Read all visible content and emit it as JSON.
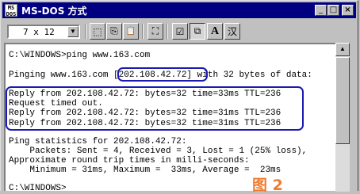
{
  "window": {
    "title": "MS-DOS 方式",
    "app_icon_text": "MS\nDOS",
    "minimize_glyph": "_",
    "maximize_glyph": "□",
    "close_glyph": "×"
  },
  "toolbar": {
    "font_size_value": "7 x 12",
    "dropdown_glyph": "▼",
    "tool_glyphs": {
      "mark": "⬚",
      "copy": "⎘",
      "paste": "📋",
      "fullscreen": "⛶",
      "properties": "☑",
      "background": "⧉",
      "font": "A",
      "ime": "汉"
    }
  },
  "console": {
    "lines": [
      "C:\\WINDOWS>ping www.163.com",
      "",
      "Pinging www.163.com [202.108.42.72] with 32 bytes of data:",
      "",
      "Reply from 202.108.42.72: bytes=32 time=33ms TTL=236",
      "Request timed out.",
      "Reply from 202.108.42.72: bytes=32 time=31ms TTL=236",
      "Reply from 202.108.42.72: bytes=32 time=31ms TTL=236",
      "",
      "Ping statistics for 202.108.42.72:",
      "    Packets: Sent = 4, Received = 3, Lost = 1 (25% loss),",
      "Approximate round trip times in milli-seconds:",
      "    Minimum = 31ms, Maximum =  33ms, Average =  23ms",
      "",
      "C:\\WINDOWS>"
    ]
  },
  "scrollbar": {
    "up_glyph": "▲",
    "down_glyph": "▼"
  },
  "figure_label": "图 2",
  "colors": {
    "titlebar": "#000080",
    "highlight": "#1a1ab0",
    "figure_label": "#f07a2e"
  }
}
